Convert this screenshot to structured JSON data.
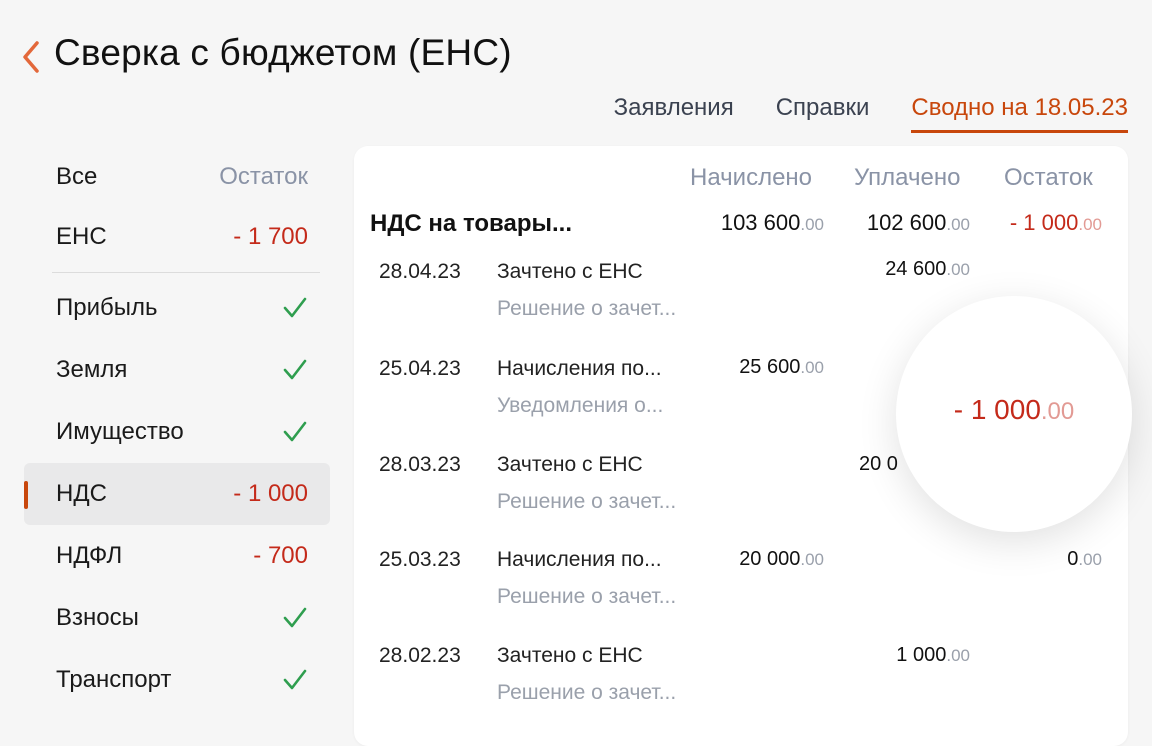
{
  "header": {
    "title": "Сверка с бюджетом (ЕНС)"
  },
  "tabs": [
    {
      "label": "Заявления",
      "active": false
    },
    {
      "label": "Справки",
      "active": false
    },
    {
      "label": "Сводно на 18.05.23",
      "active": true
    }
  ],
  "sidebar": {
    "header": {
      "left": "Все",
      "right": "Остаток"
    },
    "ens": {
      "label": "ЕНС",
      "value": "- 1 700"
    },
    "items": [
      {
        "label": "Прибыль",
        "status": "ok"
      },
      {
        "label": "Земля",
        "status": "ok"
      },
      {
        "label": "Имущество",
        "status": "ok"
      },
      {
        "label": "НДС",
        "value": "- 1 000",
        "selected": true
      },
      {
        "label": "НДФЛ",
        "value": "- 700"
      },
      {
        "label": "Взносы",
        "status": "ok"
      },
      {
        "label": "Транспорт",
        "status": "ok"
      }
    ]
  },
  "table": {
    "columns": [
      "Начислено",
      "Уплачено",
      "Остаток"
    ],
    "summary": {
      "title": "НДС на товары...",
      "accrued": "103 600",
      "accrued_c": ".00",
      "paid": "102 600",
      "paid_c": ".00",
      "balance": "- 1 000",
      "balance_c": ".00"
    },
    "rows": [
      {
        "date": "28.04.23",
        "title": "Зачтено с ЕНС",
        "subtitle": "Решение о зачет...",
        "paid": "24 600",
        "paid_c": ".00"
      },
      {
        "date": "25.04.23",
        "title": "Начисления по...",
        "subtitle": "Уведомления о...",
        "accrued": "25 600",
        "accrued_c": ".00"
      },
      {
        "date": "28.03.23",
        "title": "Зачтено с ЕНС",
        "subtitle": "Решение о зачет...",
        "paid": "20 0",
        "paid_c": ""
      },
      {
        "date": "25.03.23",
        "title": "Начисления по...",
        "subtitle": "Решение о зачет...",
        "accrued": "20 000",
        "accrued_c": ".00",
        "balance": "0",
        "balance_c": ".00"
      },
      {
        "date": "28.02.23",
        "title": "Зачтено с ЕНС",
        "subtitle": "Решение о зачет...",
        "paid": "1 000",
        "paid_c": ".00"
      }
    ]
  },
  "magnifier": {
    "value": "- 1 000",
    "value_c": ".00"
  },
  "colors": {
    "accent": "#c8470c",
    "negative": "#c42a1a",
    "positive": "#2f9e4f"
  }
}
